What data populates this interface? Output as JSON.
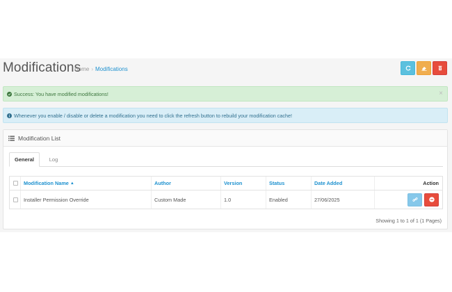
{
  "header": {
    "title": "Modifications",
    "breadcrumb": [
      {
        "label": "Home"
      },
      {
        "label": "Modifications"
      }
    ],
    "buttons": {
      "refresh_icon": "refresh-icon",
      "clear_icon": "eraser-icon",
      "delete_icon": "trash-icon"
    }
  },
  "alerts": {
    "success": "Success: You have modified modifications!",
    "success_close": "×",
    "info": "Whenever you enable / disable or delete a modification you need to click the refresh button to rebuild your modification cache!"
  },
  "panel": {
    "title": "Modification List",
    "tabs": [
      {
        "label": "General",
        "active": true
      },
      {
        "label": "Log",
        "active": false
      }
    ]
  },
  "table": {
    "columns": {
      "name": "Modification Name",
      "author": "Author",
      "version": "Version",
      "status": "Status",
      "date_added": "Date Added",
      "action": "Action"
    },
    "rows": [
      {
        "name": "Installer Permission Override",
        "author": "Custom Made",
        "version": "1.0",
        "status": "Enabled",
        "date_added": "27/06/2025"
      }
    ]
  },
  "pagination": {
    "info": "Showing 1 to 1 of 1 (1 Pages)"
  },
  "colors": {
    "link": "#1e91cf",
    "info_button": "#5bc0de",
    "warning_button": "#f0ad4e",
    "danger_button": "#e74c3c",
    "success_bg": "#d6efd6",
    "info_bg": "#d9eef7"
  }
}
